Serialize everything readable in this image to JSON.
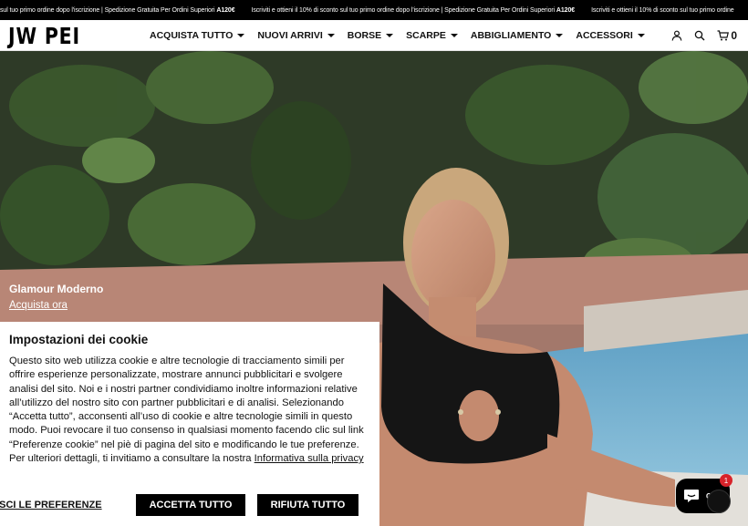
{
  "announcement": {
    "segments": [
      {
        "text": "sul tuo primo ordine dopo l'iscrizione | Spedizione Gratuita Per Ordini Superiori ",
        "bold": "A120€"
      },
      {
        "text": "Iscriviti e ottieni il 10% di sconto sul tuo primo ordine dopo l'iscrizione | Spedizione Gratuita Per Ordini Superiori ",
        "bold": "A120€"
      },
      {
        "text": "Iscriviti e ottieni il 10% di sconto sul tuo primo ordine",
        "bold": ""
      }
    ]
  },
  "header": {
    "logo": "JW PEI",
    "nav": [
      {
        "label": "ACQUISTA TUTTO"
      },
      {
        "label": "NUOVI ARRIVI"
      },
      {
        "label": "BORSE"
      },
      {
        "label": "SCARPE"
      },
      {
        "label": "ABBIGLIAMENTO"
      },
      {
        "label": "ACCESSORI"
      }
    ],
    "icons": [
      "user-icon",
      "search-icon",
      "cart-icon"
    ],
    "cart_count": "0"
  },
  "hero": {
    "title": "Glamour Moderno",
    "link": "Acquista ora"
  },
  "cookie": {
    "title": "Impostazioni dei cookie",
    "body": "Questo sito web utilizza cookie e altre tecnologie di tracciamento simili per offrire esperienze personalizzate, mostrare annunci pubblicitari e svolgere analisi del sito. Noi e i nostri partner condividiamo inoltre informazioni relative all’utilizzo del nostro sito con partner pubblicitari e di analisi. Selezionando “Accetta tutto”, acconsenti all’uso di cookie e altre tecnologie simili in questo modo. Puoi revocare il tuo consenso in qualsiasi momento facendo clic sul link “Preferenze cookie” nel piè di pagina del sito e modificando le tue preferenze. Per ulteriori dettagli, ti invitiamo a consultare la nostra ",
    "privacy_link": "Informativa sulla privacy",
    "preferences_label": "STISCI LE PREFERENZE",
    "accept_label": "ACCETTA TUTTO",
    "reject_label": "RIFIUTA TUTTO"
  },
  "chat": {
    "label": "Chat",
    "badge": "1"
  },
  "colors": {
    "announcement_bg": "#000000",
    "button_bg": "#000000",
    "badge": "#d8232a"
  }
}
